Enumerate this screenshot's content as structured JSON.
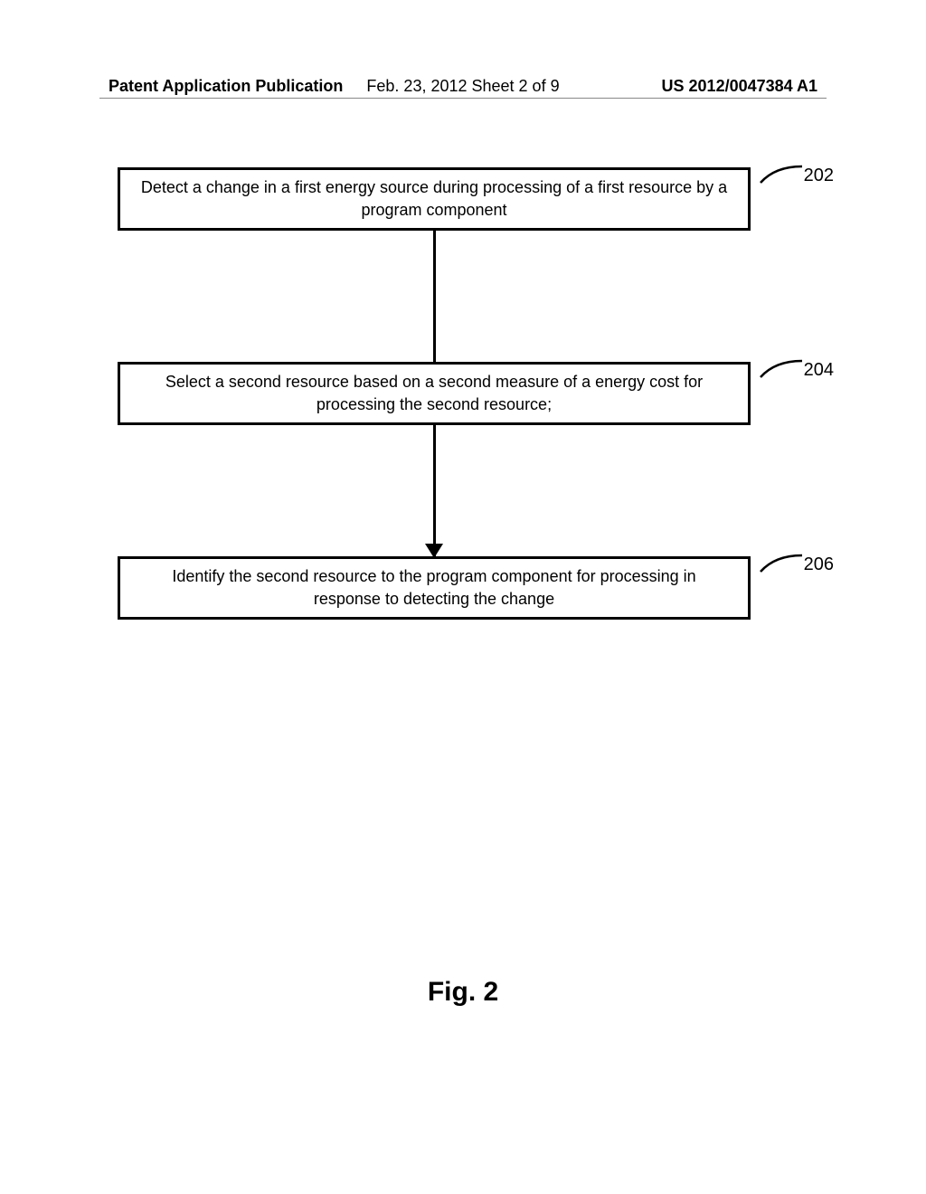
{
  "header": {
    "left": "Patent Application Publication",
    "center": "Feb. 23, 2012  Sheet 2 of 9",
    "right": "US 2012/0047384 A1"
  },
  "flowchart": {
    "boxes": [
      {
        "text": "Detect a change in a first energy source during processing of a first resource by a program component",
        "label": "202"
      },
      {
        "text": "Select a second resource based on a second measure of a energy cost for processing the second resource;",
        "label": "204"
      },
      {
        "text": "Identify the second resource to the program component for processing in response to detecting the change",
        "label": "206"
      }
    ]
  },
  "figure_label": "Fig. 2"
}
